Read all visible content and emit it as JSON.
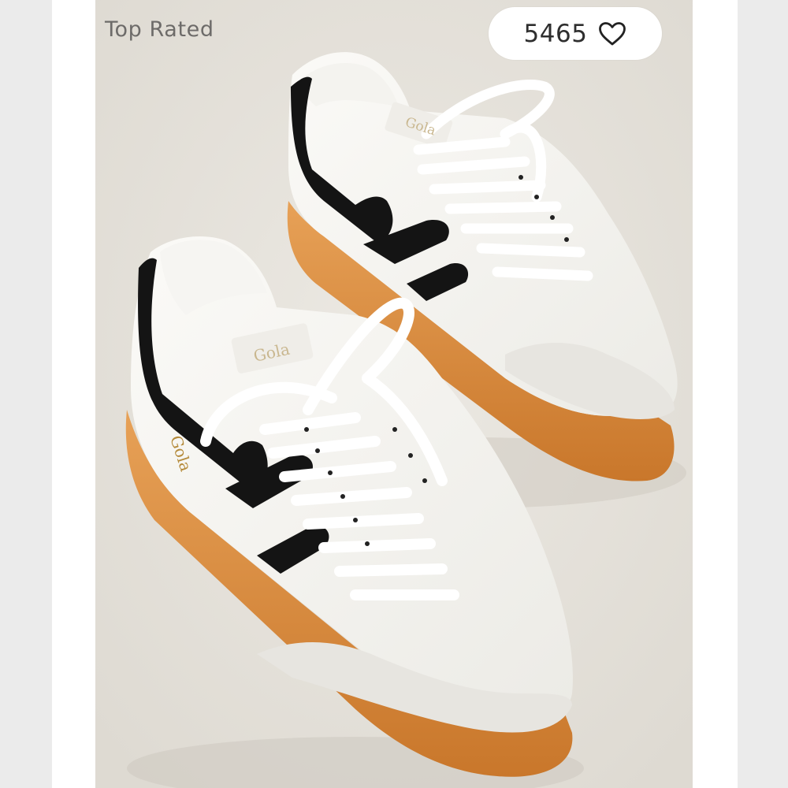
{
  "badge": {
    "label": "Top Rated"
  },
  "likes": {
    "count": "5465",
    "icon": "heart-outline-icon"
  },
  "product_image": {
    "brand_marks": [
      "Gola",
      "Gola",
      "Gola"
    ],
    "colors": {
      "upper": "#f6f5f1",
      "suede": "#e7e5e0",
      "stripe": "#141414",
      "sole": "#d98b3a",
      "backdrop": "#e8e4dd"
    }
  }
}
